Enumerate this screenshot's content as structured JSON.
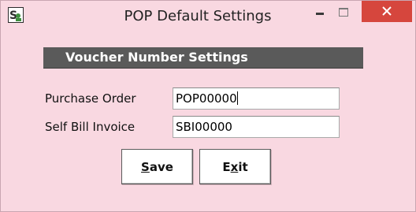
{
  "window": {
    "title": "POP Default Settings",
    "background_color": "#f9d8e1",
    "icons": {
      "app": "app-logo-icon",
      "minimize": "minimize-icon",
      "maximize": "maximize-icon",
      "close": "close-icon"
    },
    "close_button_color": "#d6463d"
  },
  "section": {
    "header": "Voucher Number Settings",
    "header_color": "#5a5a5a"
  },
  "fields": {
    "purchase_order": {
      "label": "Purchase Order",
      "value": "POP00000"
    },
    "self_bill_invoice": {
      "label": "Self Bill Invoice",
      "value": "SBI00000"
    }
  },
  "buttons": {
    "save": {
      "label_underlined": "S",
      "label_rest": "ave"
    },
    "exit": {
      "label_start": "E",
      "label_underlined": "x",
      "label_rest": "it"
    }
  }
}
